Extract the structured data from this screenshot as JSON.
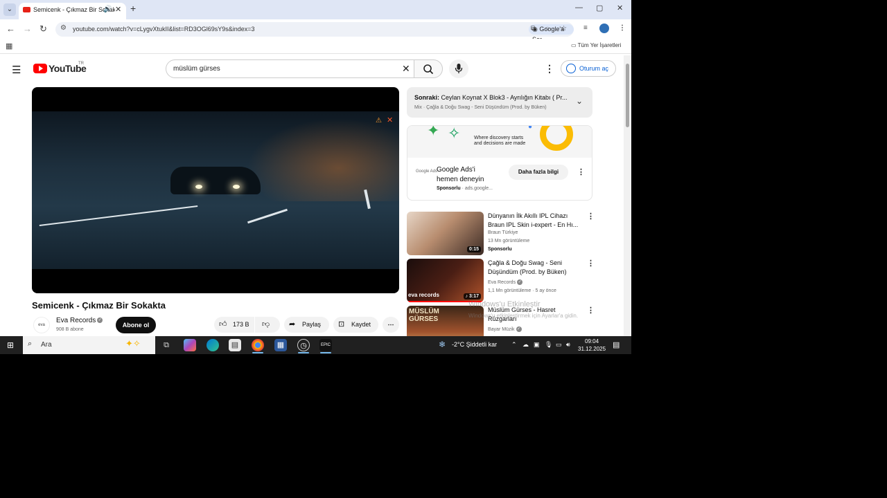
{
  "browser": {
    "tab_title": "Semicenk - Çıkmaz Bir Sokak",
    "url": "youtube.com/watch?v=cLygvXtukII&list=RD3OGl69sY9s&index=3",
    "google_sor": "Google'a Sor",
    "bookmarks_all": "Tüm Yer İşaretleri"
  },
  "yt": {
    "logo": "YouTube",
    "region": "TR",
    "search_value": "müslüm gürses",
    "signin": "Oturum aç"
  },
  "video": {
    "title": "Semicenk - Çıkmaz Bir Sokakta",
    "channel": "Eva Records",
    "channel_avatar": "eva",
    "subs": "908 B abone",
    "subscribe": "Abone ol",
    "likes": "173 B",
    "share": "Paylaş",
    "save": "Kaydet"
  },
  "upnext": {
    "line1_label": "Sonraki:",
    "line1": "Ceylan Koynat X Blok3 - Ayrılığın Kitabı ( Pr...",
    "line2": "Mix · Çağla & Doğu Swag - Seni Düşündüm (Prod. by Büken)"
  },
  "ad": {
    "banner_text1": "Where discovery starts",
    "banner_text2": "and decisions are made",
    "logo": "Google Ads",
    "title1": "Google Ads'i",
    "title2": "hemen deneyin",
    "sponsored": "Sponsorlu",
    "domain": "· ads.google...",
    "cta": "Daha fazla bilgi"
  },
  "recs": [
    {
      "title": "Dünyanın İlk Akıllı IPL Cihazı Braun IPL Skin i-expert - En Hı...",
      "channel": "Braun Türkiye",
      "meta": "13 Mn görüntüleme",
      "extra": "Sponsorlu",
      "duration": "0:15"
    },
    {
      "title": "Çağla & Doğu Swag - Seni Düşündüm (Prod. by Büken)",
      "channel": "Eva Records",
      "meta": "1,1 Mn görüntüleme · 5 ay önce",
      "extra": "",
      "duration": "3:17",
      "thumb_text": "eva records"
    },
    {
      "title": "Müslüm Gürses - Hasret Rüzgarları",
      "channel": "Bayar Müzik",
      "meta": "",
      "extra": "",
      "duration": "",
      "thumb_text": "MÜSLÜM GÜRSES"
    }
  ],
  "watermark": {
    "line1": "Windows'u Etkinleştir",
    "line2": "Windows'u etkinleştirmek için Ayarlar'a gidin."
  },
  "taskbar": {
    "search": "Ara",
    "weather": "-2°C  Şiddetli kar",
    "time": "09:04",
    "date": "31.12.2025"
  }
}
